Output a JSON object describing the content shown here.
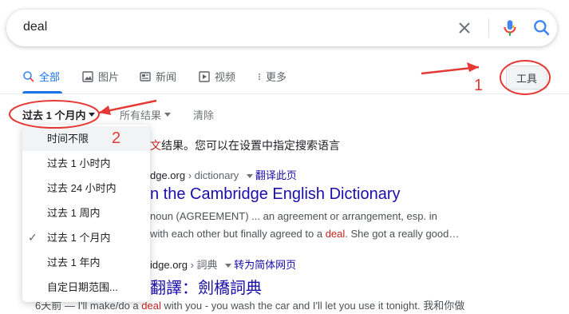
{
  "search": {
    "query": "deal"
  },
  "tabs": [
    {
      "label": "全部",
      "icon": "search-icon",
      "active": true
    },
    {
      "label": "图片",
      "icon": "image-icon",
      "active": false
    },
    {
      "label": "新闻",
      "icon": "news-icon",
      "active": false
    },
    {
      "label": "视频",
      "icon": "video-icon",
      "active": false
    },
    {
      "label": "更多",
      "icon": "more-vert-icon",
      "active": false
    }
  ],
  "tools_button": "工具",
  "filters": {
    "time": "过去 1 个月内",
    "results": "所有结果",
    "clear": "清除"
  },
  "time_menu": {
    "items": [
      {
        "label": "时间不限",
        "checked": false
      },
      {
        "label": "过去 1 小时内",
        "checked": false
      },
      {
        "label": "过去 24 小时内",
        "checked": false
      },
      {
        "label": "过去 1 周内",
        "checked": false
      },
      {
        "label": "过去 1 个月内",
        "checked": true
      },
      {
        "label": "过去 1 年内",
        "checked": false
      },
      {
        "label": "自定日期范围...",
        "checked": false
      }
    ]
  },
  "results": {
    "notice_hl": "文",
    "notice_rest": "结果。您可以在设置中指定搜索语言",
    "r1": {
      "cite_domain": "dge.org",
      "cite_path": " › dictionary",
      "translate": "翻译此页",
      "title": "n the Cambridge English Dictionary",
      "snip1": "noun (AGREEMENT) ... an agreement or arrangement, esp. in",
      "snip2_a": "with each other but finally agreed to a ",
      "snip2_hl": "deal",
      "snip2_b": ". She got a really good…"
    },
    "r2": {
      "cite_domain": "idge.org",
      "cite_path": " › 詞典",
      "translate": "转为简体网页",
      "title": "翻譯：劍橋詞典",
      "snip_a": "6天前 — I'll make/do a ",
      "snip_hl": "deal",
      "snip_b": " with you - you wash the car and I'll let you use it tonight. 我和你做"
    }
  },
  "annotations": {
    "num1": "1",
    "num2": "2",
    "color": "#e53935"
  },
  "colors": {
    "accent": "#1a73e8",
    "link": "#1a0dab",
    "highlight": "#c5221f"
  }
}
